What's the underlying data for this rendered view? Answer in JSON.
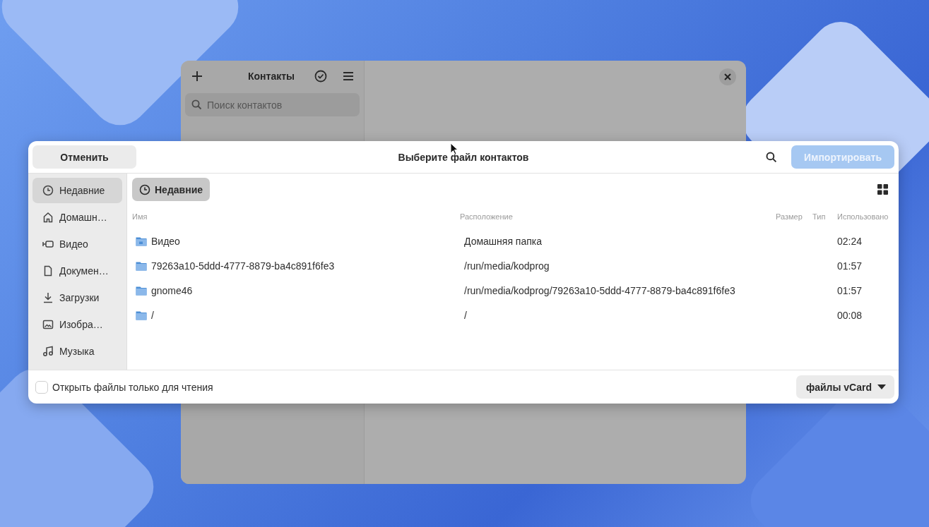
{
  "background_window": {
    "title": "Контакты",
    "search": {
      "placeholder": "Поиск контактов"
    }
  },
  "dialog": {
    "title": "Выберите файл контактов",
    "cancel_button": "Отменить",
    "import_button": {
      "label": "Импортировать",
      "disabled": true
    },
    "sidebar": {
      "items": [
        {
          "label": "Недавние",
          "kind": "recent",
          "selected": true
        },
        {
          "label": "Домашн…",
          "kind": "home",
          "selected": false
        },
        {
          "label": "Видео",
          "kind": "video",
          "selected": false
        },
        {
          "label": "Докумен…",
          "kind": "document",
          "selected": false
        },
        {
          "label": "Загрузки",
          "kind": "download",
          "selected": false
        },
        {
          "label": "Изобра…",
          "kind": "image",
          "selected": false
        },
        {
          "label": "Музыка",
          "kind": "music",
          "selected": false
        }
      ]
    },
    "path_button": "Недавние",
    "table": {
      "columns": [
        "Имя",
        "Расположение",
        "Размер",
        "Тип",
        "Использовано"
      ],
      "rows": [
        {
          "name": "Видео",
          "kind": "video-folder",
          "location": "Домашняя папка",
          "used": "02:24"
        },
        {
          "name": "79263a10-5ddd-4777-8879-ba4c891f6fe3",
          "kind": "folder",
          "location": "/run/media/kodprog",
          "used": "01:57"
        },
        {
          "name": "gnome46",
          "kind": "folder",
          "location": "/run/media/kodprog/79263a10-5ddd-4777-8879-ba4c891f6fe3",
          "used": "01:57"
        },
        {
          "name": "/",
          "kind": "folder",
          "location": "/",
          "used": "00:08"
        }
      ]
    },
    "read_only": {
      "label": "Открыть файлы только для чтения",
      "checked": false
    },
    "filter": {
      "label": "файлы vCard"
    }
  }
}
